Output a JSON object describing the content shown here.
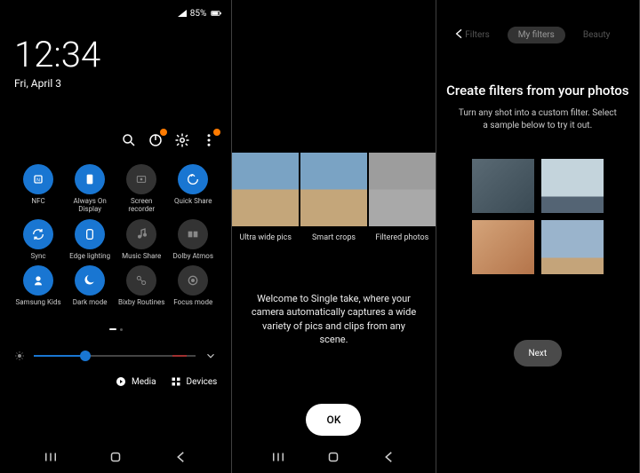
{
  "screen1": {
    "status": {
      "battery": "85%"
    },
    "time": "12:34",
    "date": "Fri, April 3",
    "tools": {
      "search": "search-icon",
      "power": "power-off-icon",
      "settings": "gear-icon",
      "more": "more-icon"
    },
    "toggles": [
      {
        "label": "NFC",
        "icon": "nfc-icon",
        "on": true
      },
      {
        "label": "Always On Display",
        "icon": "always-on-icon",
        "on": true
      },
      {
        "label": "Screen recorder",
        "icon": "screen-recorder-icon",
        "on": false
      },
      {
        "label": "Quick Share",
        "icon": "quick-share-icon",
        "on": true
      },
      {
        "label": "Sync",
        "icon": "sync-icon",
        "on": true
      },
      {
        "label": "Edge lighting",
        "icon": "edge-lighting-icon",
        "on": true
      },
      {
        "label": "Music Share",
        "icon": "music-share-icon",
        "on": false
      },
      {
        "label": "Dolby Atmos",
        "icon": "dolby-icon",
        "on": false
      },
      {
        "label": "Samsung Kids",
        "icon": "kids-icon",
        "on": true
      },
      {
        "label": "Dark mode",
        "icon": "dark-mode-icon",
        "on": true
      },
      {
        "label": "Bixby Routines",
        "icon": "bixby-icon",
        "on": false
      },
      {
        "label": "Focus mode",
        "icon": "focus-icon",
        "on": false
      }
    ],
    "brightness": 32,
    "media_label": "Media",
    "devices_label": "Devices"
  },
  "screen2": {
    "carousel": [
      {
        "label": "Ultra wide pics"
      },
      {
        "label": "Smart crops"
      },
      {
        "label": "Filtered photos"
      }
    ],
    "welcome": "Welcome to Single take, where your camera automatically captures a wide variety of pics and clips from any scene.",
    "ok": "OK"
  },
  "screen3": {
    "tabs": [
      {
        "label": "Filters",
        "active": false
      },
      {
        "label": "My filters",
        "active": true
      },
      {
        "label": "Beauty",
        "active": false
      }
    ],
    "title": "Create filters from your photos",
    "desc": "Turn any shot into a custom filter. Select a sample below to try it out.",
    "next": "Next"
  }
}
